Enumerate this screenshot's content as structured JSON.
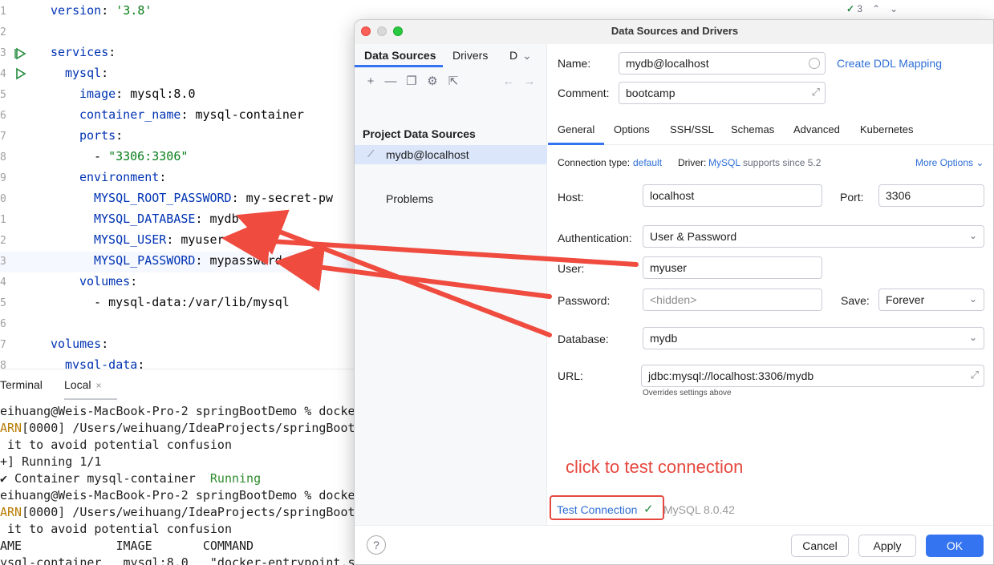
{
  "editor": {
    "toolbar": {
      "check_count": "3"
    },
    "gutter": [
      "1",
      "2",
      "3",
      "4",
      "5",
      "6",
      "7",
      "8",
      "9",
      "0",
      "1",
      "2",
      "3",
      "4",
      "5",
      "6",
      "7",
      "8"
    ],
    "lines": [
      {
        "key": "version",
        "sep": ": ",
        "val": "'3.8'",
        "indent": 0
      },
      {
        "key": "",
        "sep": "",
        "val": "",
        "indent": 0
      },
      {
        "key": "services",
        "sep": ":",
        "val": "",
        "indent": 0
      },
      {
        "key": "mysql",
        "sep": ":",
        "val": "",
        "indent": 1
      },
      {
        "key": "image",
        "sep": ": ",
        "val": "mysql:8.0",
        "indent": 2
      },
      {
        "key": "container_name",
        "sep": ": ",
        "val": "mysql-container",
        "indent": 2
      },
      {
        "key": "ports",
        "sep": ":",
        "val": "",
        "indent": 2
      },
      {
        "key": "- ",
        "sep": "",
        "val": "\"3306:3306\"",
        "indent": 3
      },
      {
        "key": "environment",
        "sep": ":",
        "val": "",
        "indent": 2
      },
      {
        "key": "MYSQL_ROOT_PASSWORD",
        "sep": ": ",
        "val": "my-secret-pw",
        "indent": 3
      },
      {
        "key": "MYSQL_DATABASE",
        "sep": ": ",
        "val": "mydb",
        "indent": 3
      },
      {
        "key": "MYSQL_USER",
        "sep": ": ",
        "val": "myuser",
        "indent": 3
      },
      {
        "key": "MYSQL_PASSWORD",
        "sep": ": ",
        "val": "mypassword",
        "indent": 3
      },
      {
        "key": "volumes",
        "sep": ":",
        "val": "",
        "indent": 2
      },
      {
        "key": "- ",
        "sep": "",
        "val": "mysql-data:/var/lib/mysql",
        "indent": 3
      },
      {
        "key": "",
        "sep": "",
        "val": "",
        "indent": 0
      },
      {
        "key": "volumes",
        "sep": ":",
        "val": "",
        "indent": 0
      },
      {
        "key": "mysql-data",
        "sep": ":",
        "val": "",
        "indent": 1
      }
    ]
  },
  "terminal": {
    "title": "Terminal",
    "tab": "Local",
    "lines": [
      {
        "a": "eihuang@Weis-MacBook-Pro-2 springBootDemo % docke",
        "b": "",
        "kind": "plain"
      },
      {
        "a": "ARN",
        "b": "[0000] /Users/weihuang/IdeaProjects/springBoot",
        "kind": "warn"
      },
      {
        "a": " it to avoid potential confusion",
        "b": "",
        "kind": "plain"
      },
      {
        "a": "+] Running 1/1",
        "b": "",
        "kind": "plain"
      },
      {
        "a": "✔ Container mysql-container  ",
        "b": "Running",
        "kind": "green"
      },
      {
        "a": "eihuang@Weis-MacBook-Pro-2 springBootDemo % docke",
        "b": "",
        "kind": "plain"
      },
      {
        "a": "ARN",
        "b": "[0000] /Users/weihuang/IdeaProjects/springBoot",
        "kind": "warn"
      },
      {
        "a": " it to avoid potential confusion",
        "b": "",
        "kind": "plain"
      },
      {
        "a": "AME             IMAGE       COMMAND",
        "b": "",
        "kind": "plain"
      },
      {
        "a": "ysql-container   mysql:8.0   \"docker-entrypoint.s",
        "b": "",
        "kind": "plain"
      }
    ]
  },
  "dialog": {
    "title": "Data Sources and Drivers",
    "left": {
      "tabs": {
        "data_sources": "Data Sources",
        "drivers": "Drivers",
        "more": "D"
      },
      "section": "Project Data Sources",
      "item": "mydb@localhost",
      "problems": "Problems"
    },
    "right": {
      "name_label": "Name:",
      "name_value": "mydb@localhost",
      "create_ddl": "Create DDL Mapping",
      "comment_label": "Comment:",
      "comment_value": "bootcamp",
      "tabs": [
        "General",
        "Options",
        "SSH/SSL",
        "Schemas",
        "Advanced",
        "Kubernetes"
      ],
      "conn_type_label": "Connection type:",
      "conn_type_value": "default",
      "driver_label": "Driver:",
      "driver_value": "MySQL",
      "driver_note": "supports since 5.2",
      "more_options": "More Options",
      "host_label": "Host:",
      "host_value": "localhost",
      "port_label": "Port:",
      "port_value": "3306",
      "auth_label": "Authentication:",
      "auth_value": "User & Password",
      "user_label": "User:",
      "user_value": "myuser",
      "password_label": "Password:",
      "password_placeholder": "<hidden>",
      "save_label": "Save:",
      "save_value": "Forever",
      "database_label": "Database:",
      "database_value": "mydb",
      "url_label": "URL:",
      "url_value": "jdbc:mysql://localhost:3306/mydb",
      "url_note": "Overrides settings above",
      "annotation": "click to test connection",
      "test_connection": "Test Connection",
      "mysql_version": "MySQL 8.0.42"
    },
    "footer": {
      "help": "?",
      "cancel": "Cancel",
      "apply": "Apply",
      "ok": "OK"
    }
  },
  "colors": {
    "accent": "#3574f0",
    "annotation": "#e5483e",
    "link": "#2f6fd6",
    "success": "#208a3c"
  }
}
